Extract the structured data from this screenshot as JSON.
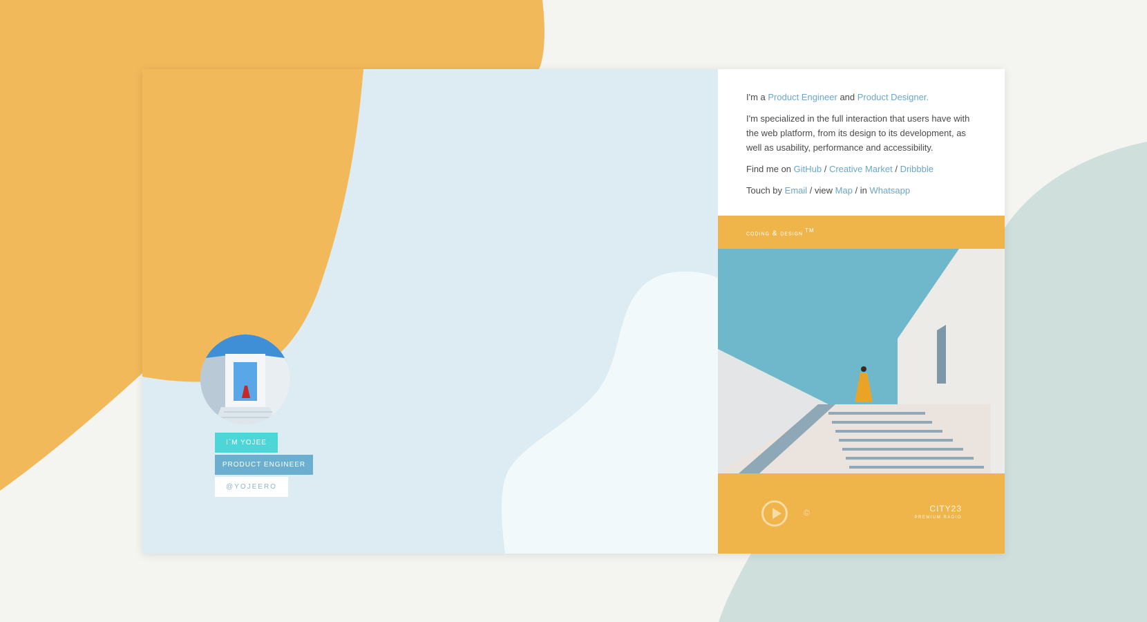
{
  "colors": {
    "background": "#f4f4f0",
    "orange": "#f2b95a",
    "accent_orange": "#efb54b",
    "hero_blue": "#dcecf2",
    "link": "#6aa7c9",
    "teal_tag": "#4dd6d8",
    "blue_tag": "#6aaed0",
    "sage": "#cfe0dc"
  },
  "bio": {
    "intro": {
      "prefix": "I'm a ",
      "role1": "Product Engineer",
      "mid": " and ",
      "role2": "Product Designer."
    },
    "summary": "I'm specialized in the full interaction that users have with the web platform, from its design to its development, as well as usability, performance and accessibility.",
    "find": {
      "prefix": "Find me on ",
      "github": "GitHub",
      "sep1": " / ",
      "creative_market": "Creative Market",
      "sep2": " / ",
      "dribbble": "Dribbble"
    },
    "touch": {
      "prefix": "Touch by ",
      "email": "Email",
      "mid1": " / view ",
      "map": "Map",
      "mid2": " / in ",
      "whatsapp": "Whatsapp"
    }
  },
  "tagline": {
    "text": "coding & design",
    "tm": "TM"
  },
  "player": {
    "play_icon": "play-icon",
    "copyright": "©",
    "station": "CITY23",
    "station_sub": "PREMIUM RADIO"
  },
  "profile": {
    "name_tag": "I`M YOJEE",
    "role_tag": "PRODUCT ENGINEER",
    "handle_tag": "@YOJEERO"
  }
}
